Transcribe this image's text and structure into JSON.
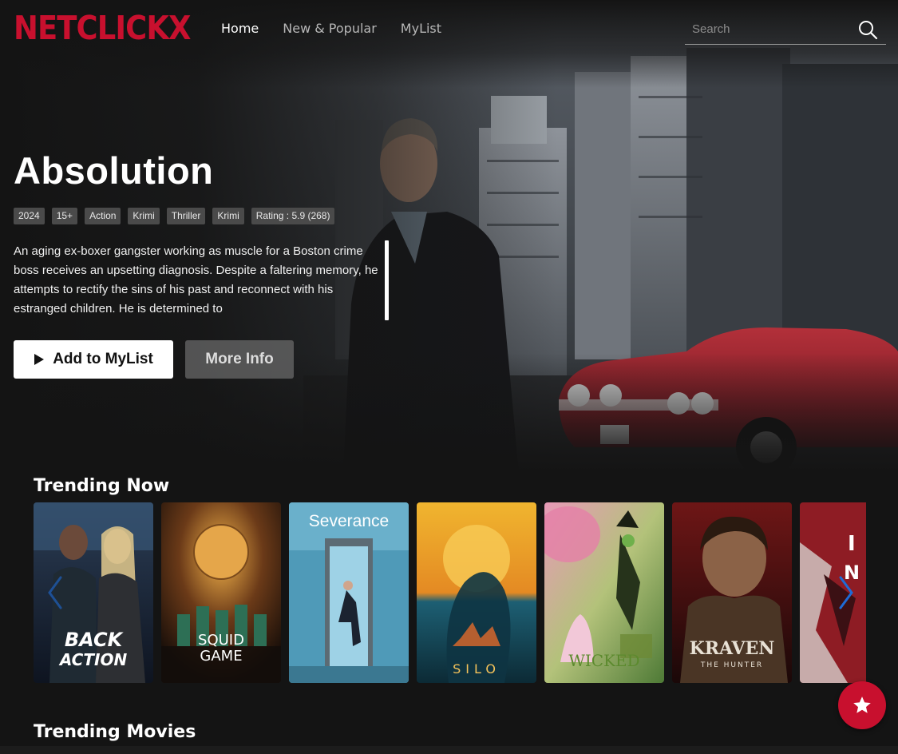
{
  "nav": {
    "logo": "NETCLICKX",
    "links": [
      {
        "label": "Home",
        "active": true
      },
      {
        "label": "New & Popular",
        "active": false
      },
      {
        "label": "MyList",
        "active": false
      }
    ],
    "search_placeholder": "Search",
    "search_icon": "search-icon"
  },
  "hero": {
    "title": "Absolution",
    "tags": [
      "2024",
      "15+",
      "Action",
      "Krimi",
      "Thriller",
      "Krimi",
      "Rating : 5.9 (268)"
    ],
    "description": "An aging ex-boxer gangster working as muscle for a Boston crime boss receives an upsetting diagnosis. Despite a faltering memory, he attempts to rectify the sins of his past and reconnect with his estranged children. He is determined to",
    "add_button_label": "Add to MyList",
    "add_button_icon": "play-icon",
    "more_button_label": "More Info"
  },
  "rows": [
    {
      "title": "Trending Now",
      "posters": [
        {
          "title": "BACK IN ACTION",
          "art_text": "BACK IN ACTION"
        },
        {
          "title": "SQUID GAME",
          "art_text": "SQUID GAME"
        },
        {
          "title": "Severance",
          "art_text": "Severance"
        },
        {
          "title": "SILO",
          "art_text": "SILO"
        },
        {
          "title": "WICKED",
          "art_text": "WICKED"
        },
        {
          "title": "KRAVEN THE HUNTER",
          "art_text": "KRAVEN THE HUNTER"
        },
        {
          "title": "",
          "art_text": ""
        }
      ]
    },
    {
      "title": "Trending Movies",
      "posters": []
    }
  ],
  "fab_icon": "star-icon",
  "colors": {
    "brand": "#c8102e",
    "background": "#141414",
    "tag_bg": "#4a4a4a",
    "arrow": "#1e6bd6"
  }
}
